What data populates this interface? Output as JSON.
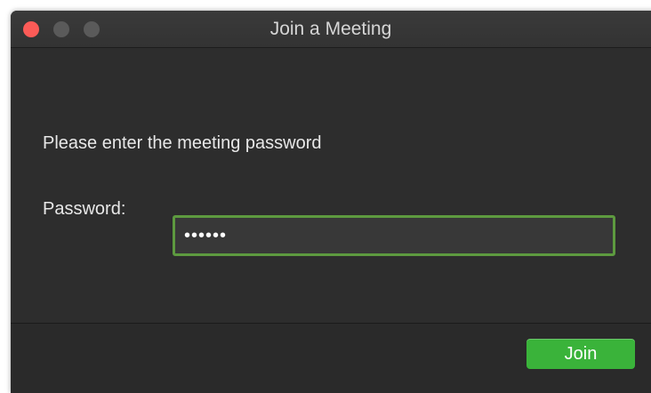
{
  "window": {
    "title": "Join a Meeting",
    "controls": [
      "close",
      "minimize",
      "zoom"
    ]
  },
  "dialog": {
    "prompt": "Please enter the meeting password",
    "password_label": "Password:",
    "password_value": "••••••"
  },
  "footer": {
    "join_label": "Join"
  },
  "colors": {
    "close": "#fc5b57",
    "input_focus_border": "#5d9a3f",
    "join_button": "#3ab33a"
  }
}
